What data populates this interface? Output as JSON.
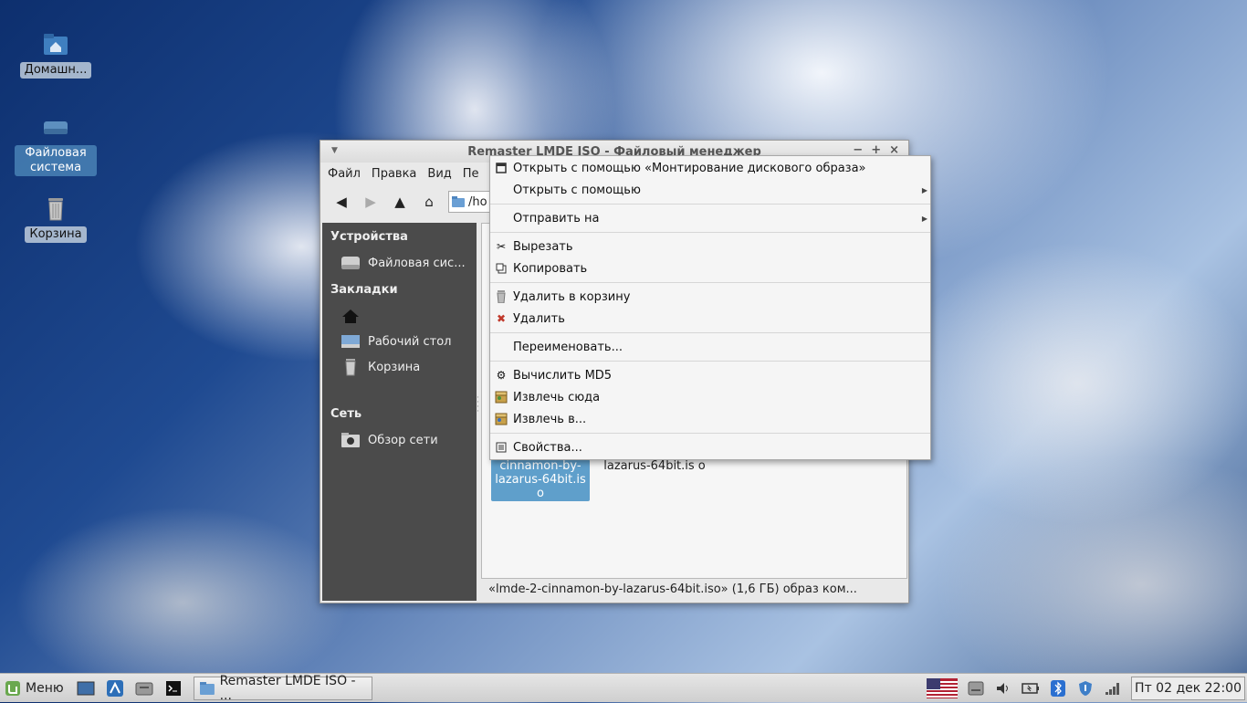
{
  "desktop": {
    "icons": [
      {
        "label": "Домашн..."
      },
      {
        "label": "Файловая система"
      },
      {
        "label": "Корзина"
      }
    ]
  },
  "window": {
    "title": "Remaster LMDE ISO - Файловый менеджер",
    "menubar": [
      "Файл",
      "Правка",
      "Вид",
      "Пе"
    ],
    "location": "/ho",
    "sidebar": {
      "devices_header": "Устройства",
      "devices": [
        {
          "label": "Файловая сис..."
        }
      ],
      "bookmarks_header": "Закладки",
      "bookmarks": [
        {
          "label": ""
        },
        {
          "label": "Рабочий стол"
        },
        {
          "label": "Корзина"
        }
      ],
      "network_header": "Сеть",
      "network": [
        {
          "label": "Обзор сети"
        }
      ]
    },
    "files": [
      {
        "name": "cinnamon-by-lazarus-64bit.is o"
      },
      {
        "name": "lazarus-64bit.is o"
      }
    ],
    "status": "«lmde-2-cinnamon-by-lazarus-64bit.iso» (1,6 ГБ) образ ком..."
  },
  "context_menu": {
    "items": [
      {
        "label": "Открыть с помощью «Монтирование дискового образа»"
      },
      {
        "label": "Открыть с помощью"
      },
      {
        "label": "Отправить на"
      },
      {
        "label": "Вырезать"
      },
      {
        "label": "Копировать"
      },
      {
        "label": "Удалить в корзину"
      },
      {
        "label": "Удалить"
      },
      {
        "label": "Переименовать..."
      },
      {
        "label": "Вычислить MD5"
      },
      {
        "label": "Извлечь сюда"
      },
      {
        "label": "Извлечь в..."
      },
      {
        "label": "Свойства..."
      }
    ]
  },
  "taskbar": {
    "menu_label": "Меню",
    "task_label": "Remaster LMDE ISO - ...",
    "clock": "Пт 02 дек 22:00"
  },
  "colors": {
    "selection": "#5f9fcb",
    "sidebar": "#4b4b4b",
    "menu_bg": "#f5f5f5"
  }
}
